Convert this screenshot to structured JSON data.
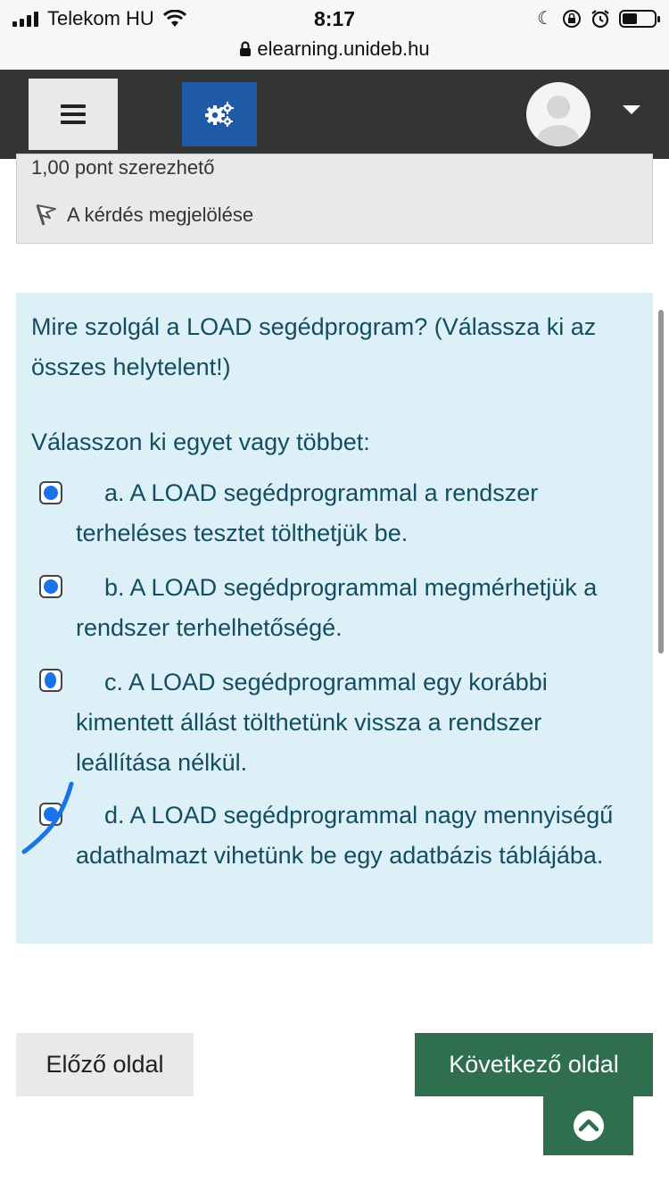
{
  "statusbar": {
    "carrier": "Telekom HU",
    "time": "8:17",
    "url": "elearning.unideb.hu",
    "icons": [
      "signal-icon",
      "wifi-icon",
      "moon-icon",
      "rotation-lock-icon",
      "alarm-icon",
      "battery-icon"
    ]
  },
  "navbar": {
    "menu_icon": "hamburger-icon",
    "settings_icon": "gears-icon",
    "user_icon": "avatar",
    "dropdown_icon": "caret-down-icon",
    "gear_color": "#1f5aa6"
  },
  "info": {
    "points": "1,00 pont szerezhető",
    "flag_label": "A kérdés megjelölése"
  },
  "question": {
    "text": "Mire szolgál a LOAD segédprogram? (Válassza ki az összes helytelent!)",
    "prompt": "Válasszon ki egyet vagy többet:",
    "answers": [
      {
        "label": "a. A LOAD segédprogrammal a rendszer terheléses tesztet tölthetjük be.",
        "checked": false
      },
      {
        "label": "b. A LOAD segédprogrammal megmérhetjük a rendszer terhelhetőségé.",
        "checked": false
      },
      {
        "label": "c. A LOAD segédprogrammal egy korábbi kimentett állást tölthetünk vissza a rendszer leállítása nélkül.",
        "checked": false
      },
      {
        "label": "d. A LOAD segédprogrammal nagy mennyiségű adathalmazt vihetünk be egy adatbázis táblájába.",
        "checked": false
      }
    ]
  },
  "buttons": {
    "prev": "Előző oldal",
    "next": "Következő oldal",
    "back_to_top_icon": "chevron-up-icon"
  },
  "colors": {
    "question_bg": "#def0f7",
    "question_text": "#134d60",
    "next_button": "#2f6e4f",
    "navbar": "#343434",
    "marker": "#1a73e8"
  }
}
